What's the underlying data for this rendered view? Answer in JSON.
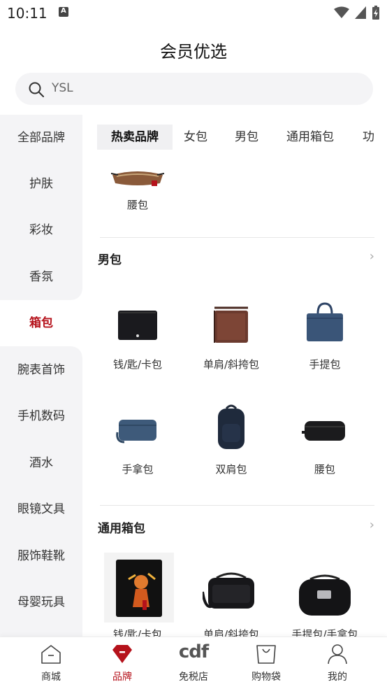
{
  "status": {
    "time": "10:11"
  },
  "header": {
    "title": "会员优选"
  },
  "search": {
    "placeholder": "YSL"
  },
  "sidebar": {
    "items": [
      {
        "label": "全部品牌"
      },
      {
        "label": "护肤"
      },
      {
        "label": "彩妆"
      },
      {
        "label": "香氛"
      },
      {
        "label": "箱包"
      },
      {
        "label": "腕表首饰"
      },
      {
        "label": "手机数码"
      },
      {
        "label": "酒水"
      },
      {
        "label": "眼镜文具"
      },
      {
        "label": "服饰鞋靴"
      },
      {
        "label": "母婴玩具"
      }
    ],
    "active_index": 4
  },
  "tabs": [
    {
      "label": "热卖品牌"
    },
    {
      "label": "女包"
    },
    {
      "label": "男包"
    },
    {
      "label": "通用箱包"
    },
    {
      "label": "功"
    }
  ],
  "top_item": {
    "label": "腰包"
  },
  "sections": [
    {
      "title": "男包",
      "items": [
        {
          "label": "钱/匙/卡包"
        },
        {
          "label": "单肩/斜挎包"
        },
        {
          "label": "手提包"
        },
        {
          "label": "手拿包"
        },
        {
          "label": "双肩包"
        },
        {
          "label": "腰包"
        }
      ]
    },
    {
      "title": "通用箱包",
      "items": [
        {
          "label": "钱/匙/卡包"
        },
        {
          "label": "单肩/斜挎包"
        },
        {
          "label": "手提包/手拿包"
        }
      ]
    }
  ],
  "bottom_nav": [
    {
      "label": "商城",
      "icon": "home-icon"
    },
    {
      "label": "品牌",
      "icon": "brand-icon"
    },
    {
      "label": "免税店",
      "icon": "cdf-logo-icon",
      "logo_text": "cdf"
    },
    {
      "label": "购物袋",
      "icon": "shopping-bag-icon"
    },
    {
      "label": "我的",
      "icon": "person-icon"
    }
  ],
  "colors": {
    "accent": "#b5121b",
    "sidebar_bg": "#f4f4f6"
  }
}
